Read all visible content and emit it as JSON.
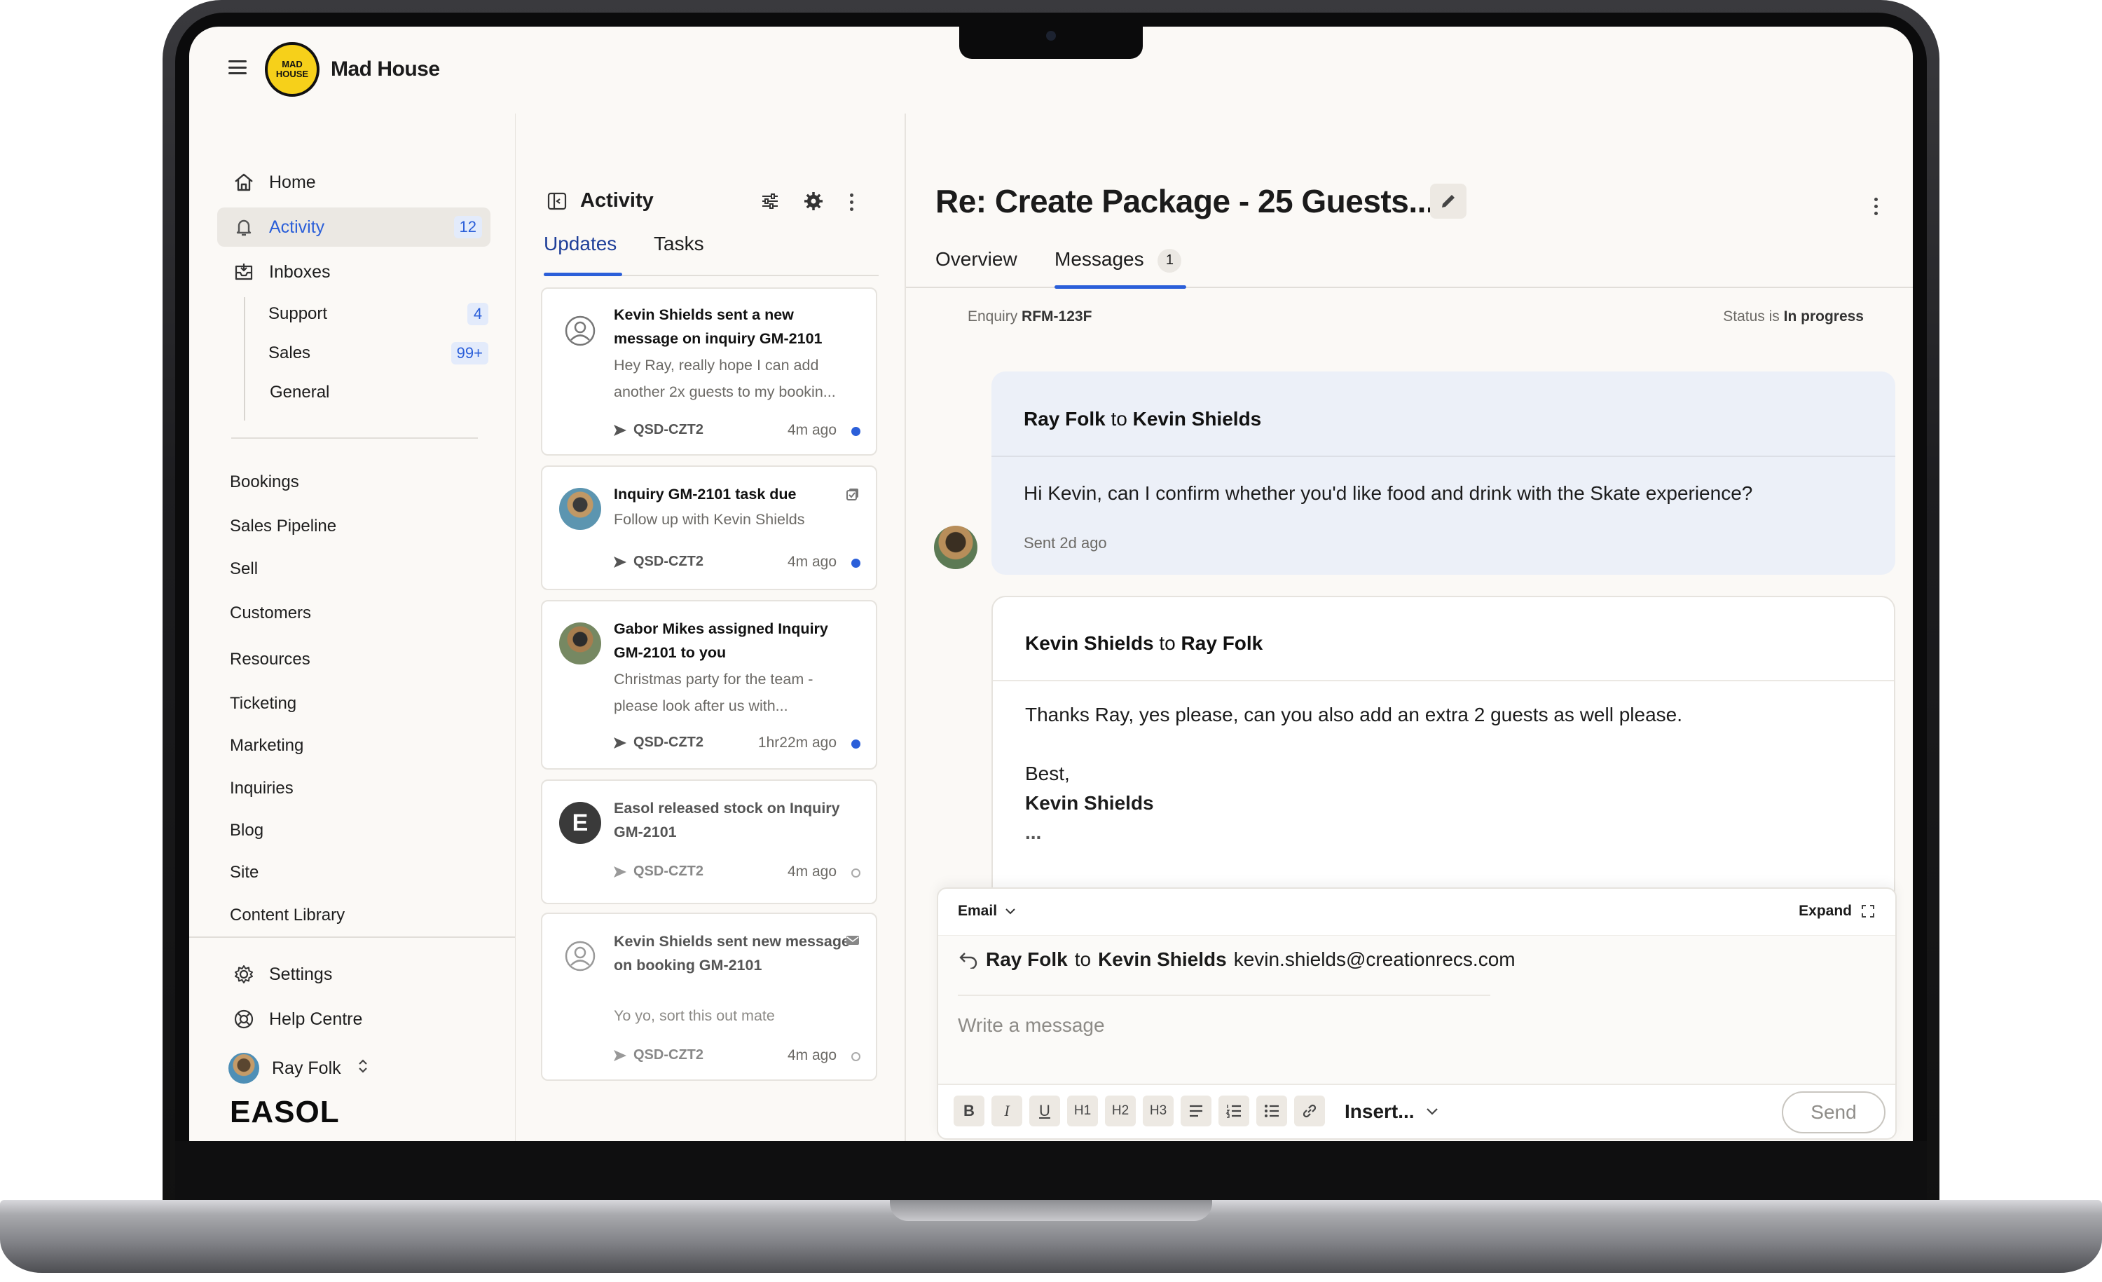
{
  "app": {
    "brand": "Mad House",
    "logo_text": "MAD HOUSE",
    "footer_brand": "EASOL"
  },
  "sidebar": {
    "home": "Home",
    "activity": {
      "label": "Activity",
      "count": "12"
    },
    "inboxes": "Inboxes",
    "inbox_items": [
      {
        "label": "Support",
        "count": "4"
      },
      {
        "label": "Sales",
        "count": "99+"
      },
      {
        "label": "General",
        "count": ""
      }
    ],
    "sections": [
      "Bookings",
      "Sales Pipeline",
      "Sell",
      "Customers",
      "Resources",
      "Ticketing",
      "Marketing",
      "Inquiries",
      "Blog",
      "Site",
      "Content Library"
    ],
    "settings": "Settings",
    "help": "Help Centre",
    "user": "Ray Folk"
  },
  "activity": {
    "title": "Activity",
    "tabs": [
      "Updates",
      "Tasks"
    ],
    "cards": [
      {
        "title": "Kevin Shields sent a new message on inquiry GM-2101",
        "body": "Hey Ray, really hope I can add another 2x guests to my bookin...",
        "code": "QSD-CZT2",
        "time": "4m ago"
      },
      {
        "title": "Inquiry GM-2101 task due",
        "body": "Follow up with Kevin Shields",
        "code": "QSD-CZT2",
        "time": "4m ago"
      },
      {
        "title": "Gabor Mikes assigned Inquiry GM-2101 to you",
        "body": "Christmas party for the team - please look after us with...",
        "code": "QSD-CZT2",
        "time": "1hr22m ago"
      },
      {
        "title": "Easol released stock on Inquiry GM-2101",
        "body": "",
        "code": "QSD-CZT2",
        "time": "4m ago",
        "avatar": "E"
      },
      {
        "title": "Kevin Shields sent new message on booking GM-2101",
        "body": "Yo yo, sort this out mate",
        "code": "QSD-CZT2",
        "time": "4m ago"
      }
    ]
  },
  "main": {
    "title": "Re: Create Package - 25 Guests...",
    "tabs": {
      "overview": "Overview",
      "messages": "Messages",
      "messages_count": "1"
    },
    "enquiry_label": "Enquiry",
    "enquiry_id": "RFM-123F",
    "status_label": "Status is",
    "status_value": "In progress",
    "messages": [
      {
        "from": "Ray Folk",
        "to_word": "to",
        "to": "Kevin Shields",
        "text": "Hi Kevin, can I confirm whether you'd like food and drink with the Skate experience?",
        "sent": "Sent 2d ago"
      },
      {
        "from": "Kevin Shields",
        "to_word": "to",
        "to": "Ray Folk",
        "text": "Thanks Ray, yes please, can you also add an extra 2 guests as well please.",
        "signoff": "Best,",
        "signature": "Kevin Shields",
        "more": "..."
      }
    ],
    "composer": {
      "mode": "Email",
      "expand": "Expand",
      "from": "Ray Folk",
      "to_word": "to",
      "to": "Kevin Shields",
      "email": "kevin.shields@creationrecs.com",
      "placeholder": "Write a message",
      "toolbar": [
        "B",
        "I",
        "U",
        "H1",
        "H2",
        "H3"
      ],
      "insert": "Insert...",
      "send": "Send"
    }
  },
  "colors": {
    "accent": "#2b5fd9",
    "background": "#fbf9f6",
    "bubble": "#ecf0f8"
  }
}
